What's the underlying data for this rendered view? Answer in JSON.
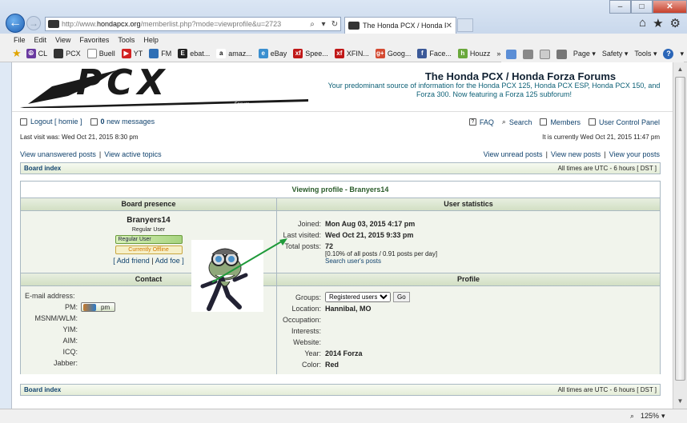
{
  "browser": {
    "url_prefix": "http://www.",
    "url_domain": "hondapcx.org",
    "url_suffix": "/memberlist.php?mode=viewprofile&u=2723",
    "tab_label": "The Honda PCX / Honda Fo...",
    "menu": [
      "File",
      "Edit",
      "View",
      "Favorites",
      "Tools",
      "Help"
    ],
    "favorites": [
      {
        "label": "CL",
        "icon": "peace-icon",
        "color": "#6a3aa0"
      },
      {
        "label": "PCX",
        "icon": "pcx-icon",
        "color": "#333333"
      },
      {
        "label": "Buell",
        "icon": "page-icon",
        "color": "#888888"
      },
      {
        "label": "YT",
        "icon": "youtube-icon",
        "color": "#d22222"
      },
      {
        "label": "FM",
        "icon": "bird-icon",
        "color": "#2f6fb5"
      },
      {
        "label": "ebat...",
        "icon": "e-icon",
        "color": "#222222"
      },
      {
        "label": "amaz...",
        "icon": "amazon-icon",
        "color": "#111111"
      },
      {
        "label": "eBay",
        "icon": "ebay-icon",
        "color": "#3a8fd0"
      },
      {
        "label": "Spee...",
        "icon": "xf-icon",
        "color": "#c01818"
      },
      {
        "label": "XFIN...",
        "icon": "xf-icon",
        "color": "#c01818"
      },
      {
        "label": "Goog...",
        "icon": "google-plus-icon",
        "color": "#d44a32"
      },
      {
        "label": "Face...",
        "icon": "facebook-icon",
        "color": "#3b5998"
      },
      {
        "label": "Houzz",
        "icon": "houzz-icon",
        "color": "#6aa83c"
      }
    ],
    "cmd": {
      "page": "Page",
      "safety": "Safety",
      "tools": "Tools"
    },
    "zoom": "125%"
  },
  "site": {
    "logo_text": "PCX",
    "logo_sub": "Forum",
    "title": "The Honda PCX / Honda Forza Forums",
    "description": "Your predominant source of information for the Honda PCX 125, Honda PCX ESP, Honda PCX 150, and Forza 300. Now featuring a Forza 125 subforum!"
  },
  "topnav": {
    "logout": "Logout [ homie ]",
    "messages_count": "0",
    "messages_label": "new messages",
    "faq": "FAQ",
    "search": "Search",
    "members": "Members",
    "ucp": "User Control Panel",
    "last_visit": "Last visit was: Wed Oct 21, 2015 8:30 pm",
    "current_time": "It is currently Wed Oct 21, 2015 11:47 pm",
    "view_unanswered": "View unanswered posts",
    "view_active": "View active topics",
    "view_unread": "View unread posts",
    "view_new": "View new posts",
    "view_yours": "View your posts",
    "sep": "|"
  },
  "navbar": {
    "board_index": "Board index",
    "timezone": "All times are UTC - 6 hours [ DST ]"
  },
  "profile": {
    "title": "Viewing profile - Branyers14",
    "presence_head": "Board presence",
    "stats_head": "User statistics",
    "username": "Branyers14",
    "rank": "Regular User",
    "rank_badge": "Regular User",
    "online_badge": "Currently Offline",
    "add_friend": "[ Add friend",
    "add_foe": "Add foe ]",
    "sep": "|",
    "stats": {
      "joined_label": "Joined:",
      "joined": "Mon Aug 03, 2015 4:17 pm",
      "last_visited_label": "Last visited:",
      "last_visited": "Wed Oct 21, 2015 9:33 pm",
      "total_posts_label": "Total posts:",
      "total_posts": "72",
      "posts_detail": "[0.10% of all posts / 0.91 posts per day]",
      "search_posts": "Search user's posts"
    },
    "contact_head": "Contact",
    "contact": {
      "email": "E-mail address:",
      "pm": "PM:",
      "pm_button": "pm",
      "msnm": "MSNM/WLM:",
      "yim": "YIM:",
      "aim": "AIM:",
      "icq": "ICQ:",
      "jabber": "Jabber:"
    },
    "profile_head": "Profile",
    "fields": {
      "groups_label": "Groups:",
      "groups_value": "Registered users",
      "go": "Go",
      "location_label": "Location:",
      "location": "Hannibal, MO",
      "occupation_label": "Occupation:",
      "interests_label": "Interests:",
      "website_label": "Website:",
      "year_label": "Year:",
      "year": "2014 Forza",
      "color_label": "Color:",
      "color": "Red"
    }
  },
  "colors": {
    "link": "#11436e",
    "panel_title": "#2b5c2b",
    "arrow": "#1f9a3a",
    "header_desc": "#0b5f75"
  }
}
